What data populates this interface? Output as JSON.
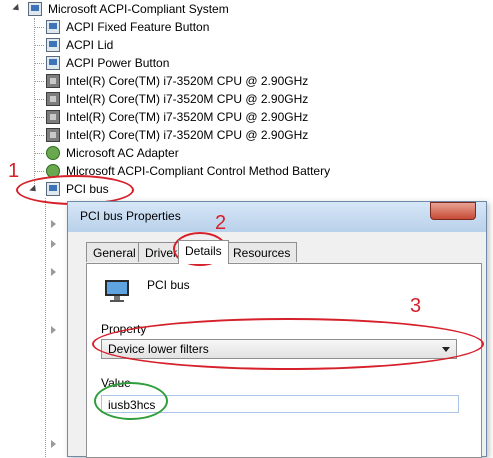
{
  "tree": {
    "root_label": "Microsoft ACPI-Compliant System",
    "children": [
      "ACPI Fixed Feature Button",
      "ACPI Lid",
      "ACPI Power Button",
      "Intel(R) Core(TM) i7-3520M CPU @ 2.90GHz",
      "Intel(R) Core(TM) i7-3520M CPU @ 2.90GHz",
      "Intel(R) Core(TM) i7-3520M CPU @ 2.90GHz",
      "Intel(R) Core(TM) i7-3520M CPU @ 2.90GHz",
      "Microsoft AC Adapter",
      "Microsoft ACPI-Compliant Control Method Battery"
    ],
    "pci_bus_label": "PCI bus"
  },
  "annotations": [
    "1",
    "2",
    "3"
  ],
  "dialog": {
    "title": "PCI bus Properties",
    "tabs": [
      "General",
      "Driver",
      "Details",
      "Resources"
    ],
    "active_tab": "Details",
    "device_name": "PCI bus",
    "property_label": "Property",
    "property_value": "Device lower filters",
    "value_label": "Value",
    "value": "iusb3hcs"
  },
  "colors": {
    "annotation_red": "#d6202a",
    "annotation_green": "#2f9e3b",
    "title_bar": "#c8dcf0"
  }
}
